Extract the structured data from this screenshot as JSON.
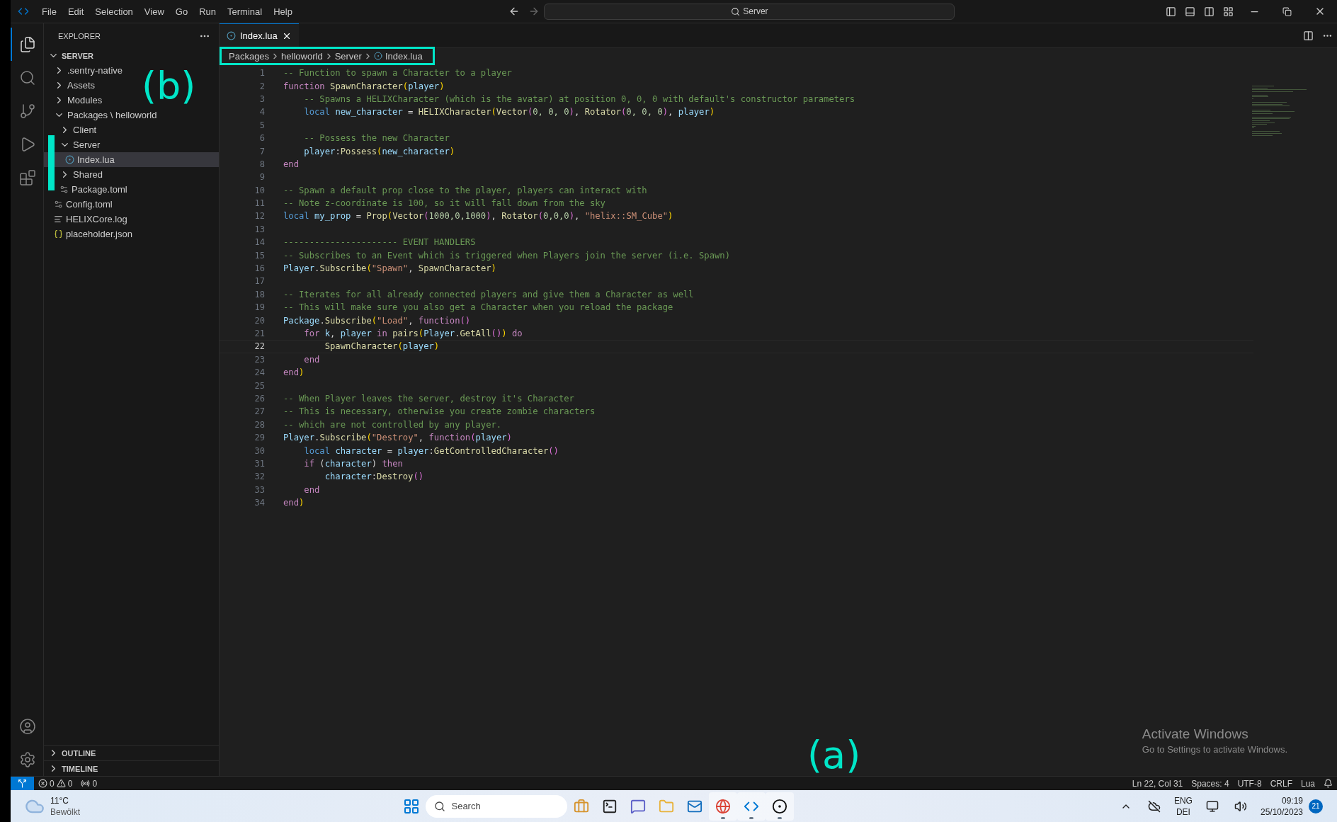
{
  "menu": [
    "File",
    "Edit",
    "Selection",
    "View",
    "Go",
    "Run",
    "Terminal",
    "Help"
  ],
  "command_center": {
    "placeholder": "Server"
  },
  "activity_bar": [
    {
      "kind": "files",
      "selected": true
    },
    {
      "kind": "search",
      "selected": false
    },
    {
      "kind": "source-control",
      "selected": false
    },
    {
      "kind": "run",
      "selected": false
    },
    {
      "kind": "extensions",
      "selected": false
    }
  ],
  "sidebar": {
    "title": "EXPLORER",
    "root": "SERVER",
    "tree": [
      {
        "label": ".sentry-native",
        "kind": "folder",
        "expanded": false,
        "selected": false
      },
      {
        "label": "Assets",
        "kind": "folder",
        "expanded": false,
        "selected": false
      },
      {
        "label": "Modules",
        "kind": "folder",
        "expanded": false,
        "selected": false
      },
      {
        "label": "Packages \\ helloworld",
        "kind": "folder",
        "expanded": true,
        "selected": false,
        "children": [
          {
            "label": "Client",
            "kind": "folder",
            "expanded": false,
            "selected": false
          },
          {
            "label": "Server",
            "kind": "folder",
            "expanded": true,
            "selected": false,
            "children": [
              {
                "label": "Index.lua",
                "kind": "lua",
                "selected": true
              }
            ]
          },
          {
            "label": "Shared",
            "kind": "folder",
            "expanded": false,
            "selected": false
          },
          {
            "label": "Package.toml",
            "kind": "config",
            "selected": false
          }
        ]
      },
      {
        "label": "Config.toml",
        "kind": "config",
        "selected": false
      },
      {
        "label": "HELIXCore.log",
        "kind": "log",
        "selected": false
      },
      {
        "label": "placeholder.json",
        "kind": "json",
        "selected": false
      }
    ],
    "panels": [
      {
        "label": "OUTLINE",
        "expanded": false
      },
      {
        "label": "TIMELINE",
        "expanded": false
      }
    ]
  },
  "tabs": [
    {
      "label": "Index.lua",
      "selected": true
    }
  ],
  "breadcrumb": [
    "Packages",
    "helloworld",
    "Server",
    "Index.lua"
  ],
  "code_lines": [
    {
      "n": "1",
      "current": false,
      "tokens": [
        {
          "text": "-- Function to spawn a Character to a player",
          "kind": "comment"
        }
      ]
    },
    {
      "n": "2",
      "current": false,
      "tokens": [
        {
          "text": "function ",
          "kind": "keyword"
        },
        {
          "text": "SpawnCharacter",
          "kind": "func"
        },
        {
          "text": "(",
          "kind": "bracket1"
        },
        {
          "text": "player",
          "kind": "var"
        },
        {
          "text": ")",
          "kind": "bracket1"
        }
      ]
    },
    {
      "n": "3",
      "current": false,
      "tokens": [
        {
          "text": "    -- Spawns a HELIXCharacter (which is the avatar) at position 0, 0, 0 with default's constructor parameters",
          "kind": "comment"
        }
      ]
    },
    {
      "n": "4",
      "current": false,
      "tokens": [
        {
          "text": "    local ",
          "kind": "storage"
        },
        {
          "text": "new_character",
          "kind": "var"
        },
        {
          "text": " = ",
          "kind": "plain"
        },
        {
          "text": "HELIXCharacter",
          "kind": "func"
        },
        {
          "text": "(",
          "kind": "bracket1"
        },
        {
          "text": "Vector",
          "kind": "func"
        },
        {
          "text": "(",
          "kind": "bracket2"
        },
        {
          "text": "0, 0, 0",
          "kind": "number"
        },
        {
          "text": ")",
          "kind": "bracket2"
        },
        {
          "text": ", ",
          "kind": "plain"
        },
        {
          "text": "Rotator",
          "kind": "func"
        },
        {
          "text": "(",
          "kind": "bracket2"
        },
        {
          "text": "0, 0, 0",
          "kind": "number"
        },
        {
          "text": ")",
          "kind": "bracket2"
        },
        {
          "text": ", ",
          "kind": "plain"
        },
        {
          "text": "player",
          "kind": "var"
        },
        {
          "text": ")",
          "kind": "bracket1"
        }
      ]
    },
    {
      "n": "5",
      "current": false
    },
    {
      "n": "6",
      "current": false,
      "tokens": [
        {
          "text": "    -- Possess the new Character",
          "kind": "comment"
        }
      ]
    },
    {
      "n": "7",
      "current": false,
      "tokens": [
        {
          "text": "    player",
          "kind": "var"
        },
        {
          "text": ":",
          "kind": "plain"
        },
        {
          "text": "Possess",
          "kind": "func"
        },
        {
          "text": "(",
          "kind": "bracket1"
        },
        {
          "text": "new_character",
          "kind": "var"
        },
        {
          "text": ")",
          "kind": "bracket1"
        }
      ]
    },
    {
      "n": "8",
      "current": false,
      "tokens": [
        {
          "text": "end",
          "kind": "keyword"
        }
      ]
    },
    {
      "n": "9",
      "current": false
    },
    {
      "n": "10",
      "current": false,
      "tokens": [
        {
          "text": "-- Spawn a default prop close to the player, players can interact with",
          "kind": "comment"
        }
      ]
    },
    {
      "n": "11",
      "current": false,
      "tokens": [
        {
          "text": "-- Note z-coordinate is 100, so it will fall down from the sky",
          "kind": "comment"
        }
      ]
    },
    {
      "n": "12",
      "current": false,
      "tokens": [
        {
          "text": "local ",
          "kind": "storage"
        },
        {
          "text": "my_prop",
          "kind": "var"
        },
        {
          "text": " = ",
          "kind": "plain"
        },
        {
          "text": "Prop",
          "kind": "func"
        },
        {
          "text": "(",
          "kind": "bracket1"
        },
        {
          "text": "Vector",
          "kind": "func"
        },
        {
          "text": "(",
          "kind": "bracket2"
        },
        {
          "text": "1000,0,1000",
          "kind": "number"
        },
        {
          "text": ")",
          "kind": "bracket2"
        },
        {
          "text": ", ",
          "kind": "plain"
        },
        {
          "text": "Rotator",
          "kind": "func"
        },
        {
          "text": "(",
          "kind": "bracket2"
        },
        {
          "text": "0,0,0",
          "kind": "number"
        },
        {
          "text": ")",
          "kind": "bracket2"
        },
        {
          "text": ", ",
          "kind": "plain"
        },
        {
          "text": "\"helix::SM_Cube\"",
          "kind": "string"
        },
        {
          "text": ")",
          "kind": "bracket1"
        }
      ]
    },
    {
      "n": "13",
      "current": false
    },
    {
      "n": "14",
      "current": false,
      "tokens": [
        {
          "text": "---------------------- EVENT HANDLERS",
          "kind": "comment"
        }
      ]
    },
    {
      "n": "15",
      "current": false,
      "tokens": [
        {
          "text": "-- Subscribes to an Event which is triggered when Players join the server (i.e. Spawn)",
          "kind": "comment"
        }
      ]
    },
    {
      "n": "16",
      "current": false,
      "tokens": [
        {
          "text": "Player",
          "kind": "var"
        },
        {
          "text": ".",
          "kind": "plain"
        },
        {
          "text": "Subscribe",
          "kind": "func"
        },
        {
          "text": "(",
          "kind": "bracket1"
        },
        {
          "text": "\"Spawn\"",
          "kind": "string"
        },
        {
          "text": ", ",
          "kind": "plain"
        },
        {
          "text": "SpawnCharacter",
          "kind": "func"
        },
        {
          "text": ")",
          "kind": "bracket1"
        }
      ]
    },
    {
      "n": "17",
      "current": false
    },
    {
      "n": "18",
      "current": false,
      "tokens": [
        {
          "text": "-- Iterates for all already connected players and give them a Character as well",
          "kind": "comment"
        }
      ]
    },
    {
      "n": "19",
      "current": false,
      "tokens": [
        {
          "text": "-- This will make sure you also get a Character when you reload the package",
          "kind": "comment"
        }
      ]
    },
    {
      "n": "20",
      "current": false,
      "tokens": [
        {
          "text": "Package",
          "kind": "var"
        },
        {
          "text": ".",
          "kind": "plain"
        },
        {
          "text": "Subscribe",
          "kind": "func"
        },
        {
          "text": "(",
          "kind": "bracket1"
        },
        {
          "text": "\"Load\"",
          "kind": "string"
        },
        {
          "text": ", ",
          "kind": "plain"
        },
        {
          "text": "function",
          "kind": "keyword"
        },
        {
          "text": "()",
          "kind": "bracket2"
        }
      ]
    },
    {
      "n": "21",
      "current": false,
      "tokens": [
        {
          "text": "    for ",
          "kind": "keyword"
        },
        {
          "text": "k",
          "kind": "var"
        },
        {
          "text": ", ",
          "kind": "plain"
        },
        {
          "text": "player",
          "kind": "var"
        },
        {
          "text": " in ",
          "kind": "keyword"
        },
        {
          "text": "pairs",
          "kind": "func"
        },
        {
          "text": "(",
          "kind": "bracket1"
        },
        {
          "text": "Player",
          "kind": "var"
        },
        {
          "text": ".",
          "kind": "plain"
        },
        {
          "text": "GetAll",
          "kind": "func"
        },
        {
          "text": "()",
          "kind": "bracket2"
        },
        {
          "text": ")",
          "kind": "bracket1"
        },
        {
          "text": " do",
          "kind": "keyword"
        }
      ]
    },
    {
      "n": "22",
      "current": true,
      "tokens": [
        {
          "text": "        SpawnCharacter",
          "kind": "func"
        },
        {
          "text": "(",
          "kind": "bracket1"
        },
        {
          "text": "player",
          "kind": "var"
        },
        {
          "text": ")",
          "kind": "bracket1"
        }
      ]
    },
    {
      "n": "23",
      "current": false,
      "tokens": [
        {
          "text": "    end",
          "kind": "keyword"
        }
      ]
    },
    {
      "n": "24",
      "current": false,
      "tokens": [
        {
          "text": "end",
          "kind": "keyword"
        },
        {
          "text": ")",
          "kind": "bracket1"
        }
      ]
    },
    {
      "n": "25",
      "current": false
    },
    {
      "n": "26",
      "current": false,
      "tokens": [
        {
          "text": "-- When Player leaves the server, destroy it's Character",
          "kind": "comment"
        }
      ]
    },
    {
      "n": "27",
      "current": false,
      "tokens": [
        {
          "text": "-- This is necessary, otherwise you create zombie characters",
          "kind": "comment"
        }
      ]
    },
    {
      "n": "28",
      "current": false,
      "tokens": [
        {
          "text": "-- which are not controlled by any player.",
          "kind": "comment"
        }
      ]
    },
    {
      "n": "29",
      "current": false,
      "tokens": [
        {
          "text": "Player",
          "kind": "var"
        },
        {
          "text": ".",
          "kind": "plain"
        },
        {
          "text": "Subscribe",
          "kind": "func"
        },
        {
          "text": "(",
          "kind": "bracket1"
        },
        {
          "text": "\"Destroy\"",
          "kind": "string"
        },
        {
          "text": ", ",
          "kind": "plain"
        },
        {
          "text": "function",
          "kind": "keyword"
        },
        {
          "text": "(",
          "kind": "bracket2"
        },
        {
          "text": "player",
          "kind": "var"
        },
        {
          "text": ")",
          "kind": "bracket2"
        }
      ]
    },
    {
      "n": "30",
      "current": false,
      "tokens": [
        {
          "text": "    local ",
          "kind": "storage"
        },
        {
          "text": "character",
          "kind": "var"
        },
        {
          "text": " = ",
          "kind": "plain"
        },
        {
          "text": "player",
          "kind": "var"
        },
        {
          "text": ":",
          "kind": "plain"
        },
        {
          "text": "GetControlledCharacter",
          "kind": "func"
        },
        {
          "text": "()",
          "kind": "bracket2"
        }
      ]
    },
    {
      "n": "31",
      "current": false,
      "tokens": [
        {
          "text": "    if",
          "kind": "keyword"
        },
        {
          "text": " (",
          "kind": "plain"
        },
        {
          "text": "character",
          "kind": "var"
        },
        {
          "text": ") ",
          "kind": "plain"
        },
        {
          "text": "then",
          "kind": "keyword"
        }
      ]
    },
    {
      "n": "32",
      "current": false,
      "tokens": [
        {
          "text": "        character",
          "kind": "var"
        },
        {
          "text": ":",
          "kind": "plain"
        },
        {
          "text": "Destroy",
          "kind": "func"
        },
        {
          "text": "()",
          "kind": "bracket2"
        }
      ]
    },
    {
      "n": "33",
      "current": false,
      "tokens": [
        {
          "text": "    end",
          "kind": "keyword"
        }
      ]
    },
    {
      "n": "34",
      "current": false,
      "tokens": [
        {
          "text": "end",
          "kind": "keyword"
        },
        {
          "text": ")",
          "kind": "bracket1"
        }
      ]
    }
  ],
  "activation_notice": {
    "title": "Activate Windows",
    "text": "Go to Settings to activate Windows."
  },
  "annotations": [
    {
      "label": "(b)"
    },
    {
      "label": "(a)"
    }
  ],
  "status_bar": {
    "errors": "0",
    "warnings": "0",
    "ports": "0",
    "position": "Ln 22, Col 31",
    "indent": "Spaces: 4",
    "encoding": "UTF-8",
    "eol": "CRLF",
    "language": "Lua"
  },
  "taskbar": {
    "temperature": "11°C",
    "weather": "Bewölkt",
    "search": {
      "placeholder": "Search"
    },
    "apps": [
      {
        "kind": "briefcase",
        "active": false
      },
      {
        "kind": "terminal",
        "active": false
      },
      {
        "kind": "chat",
        "active": false
      },
      {
        "kind": "folder",
        "active": false
      },
      {
        "kind": "mail",
        "active": false
      },
      {
        "kind": "browser",
        "active": true
      },
      {
        "kind": "editor",
        "active": true
      },
      {
        "kind": "engine",
        "active": true
      }
    ],
    "language": "ENG",
    "layout": "DEI",
    "time": "09:19",
    "date": "25/10/2023",
    "notifications": "21"
  }
}
